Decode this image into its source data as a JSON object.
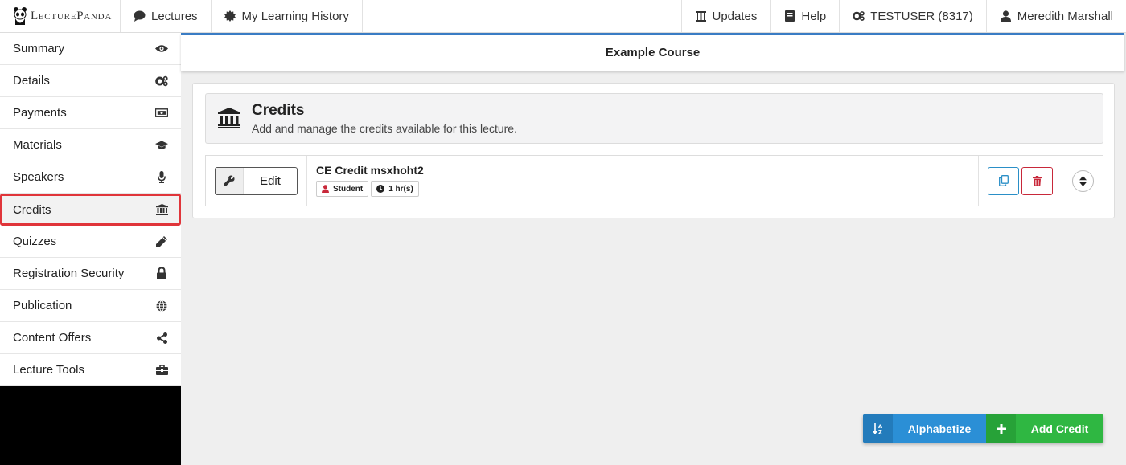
{
  "brand": {
    "name_first": "L",
    "name_rest": "ECTURE",
    "name_second": "P",
    "name_rest2": "ANDA"
  },
  "topnav": {
    "lectures": "Lectures",
    "history": "My Learning History",
    "updates": "Updates",
    "help": "Help",
    "account": "TESTUSER (8317)",
    "user": "Meredith Marshall"
  },
  "sidebar": {
    "items": [
      {
        "label": "Summary",
        "icon": "eye-icon"
      },
      {
        "label": "Details",
        "icon": "cogs-icon"
      },
      {
        "label": "Payments",
        "icon": "money-icon"
      },
      {
        "label": "Materials",
        "icon": "graduation-cap-icon"
      },
      {
        "label": "Speakers",
        "icon": "microphone-icon"
      },
      {
        "label": "Credits",
        "icon": "bank-icon",
        "active": true
      },
      {
        "label": "Quizzes",
        "icon": "pencil-icon"
      },
      {
        "label": "Registration Security",
        "icon": "lock-icon"
      },
      {
        "label": "Publication",
        "icon": "globe-icon"
      },
      {
        "label": "Content Offers",
        "icon": "share-icon"
      },
      {
        "label": "Lecture Tools",
        "icon": "toolbox-icon"
      }
    ]
  },
  "course": {
    "title": "Example Course"
  },
  "panel": {
    "title": "Credits",
    "subtitle": "Add and manage the credits available for this lecture."
  },
  "credits": [
    {
      "edit_label": "Edit",
      "name": "CE Credit msxhoht2",
      "audience": "Student",
      "hours": "1 hr(s)"
    }
  ],
  "actions": {
    "alphabetize": "Alphabetize",
    "add_credit": "Add Credit"
  },
  "colors": {
    "accent_blue": "#2b8fd6",
    "accent_green": "#2fb742",
    "danger": "#c8283a",
    "active_border": "#e0353a"
  }
}
